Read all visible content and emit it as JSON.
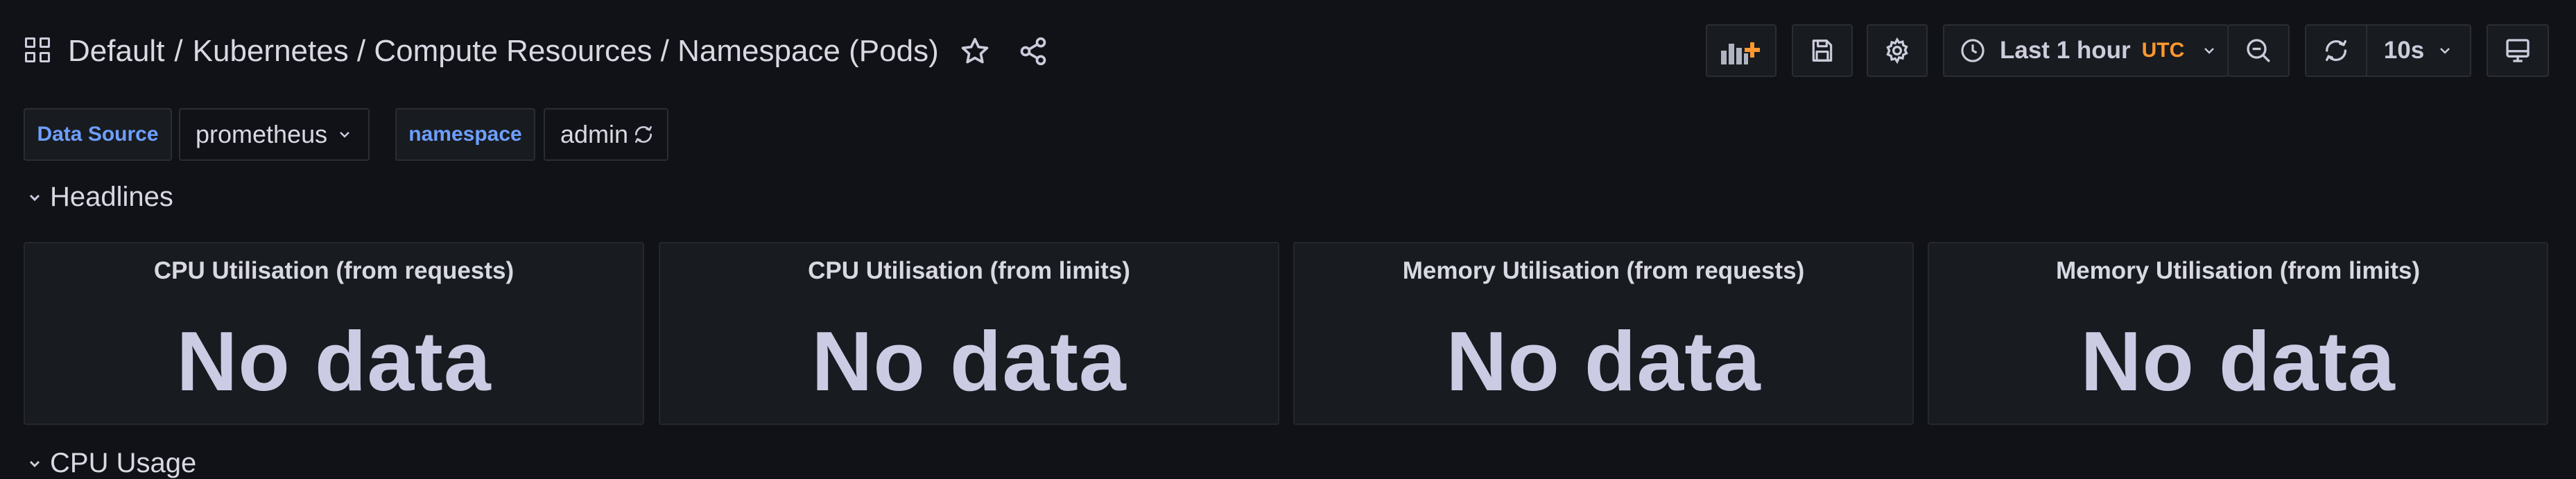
{
  "breadcrumb": {
    "folder": "Default",
    "separator": "/",
    "dashboard": "Kubernetes / Compute Resources / Namespace (Pods)"
  },
  "toolbar": {
    "time_range": "Last 1 hour",
    "timezone": "UTC",
    "refresh_interval": "10s",
    "icons": [
      "add-panel-icon",
      "save-icon",
      "settings-icon",
      "clock-icon",
      "zoom-out-icon",
      "refresh-icon",
      "tv-mode-icon"
    ]
  },
  "variables": [
    {
      "label": "Data Source",
      "value": "prometheus"
    },
    {
      "label": "namespace",
      "value": "admin"
    }
  ],
  "rows": [
    {
      "title": "Headlines"
    },
    {
      "title": "CPU Usage"
    }
  ],
  "panels": [
    {
      "title": "CPU Utilisation (from requests)",
      "value": "No data"
    },
    {
      "title": "CPU Utilisation (from limits)",
      "value": "No data"
    },
    {
      "title": "Memory Utilisation (from requests)",
      "value": "No data"
    },
    {
      "title": "Memory Utilisation (from limits)",
      "value": "No data"
    }
  ],
  "colors": {
    "background": "#111217",
    "panel": "#181b1f",
    "border": "#2a2d33",
    "accent_blue": "#6e9fff",
    "utc_orange": "#ff9830",
    "add_panel_orange": "#ff9830"
  }
}
